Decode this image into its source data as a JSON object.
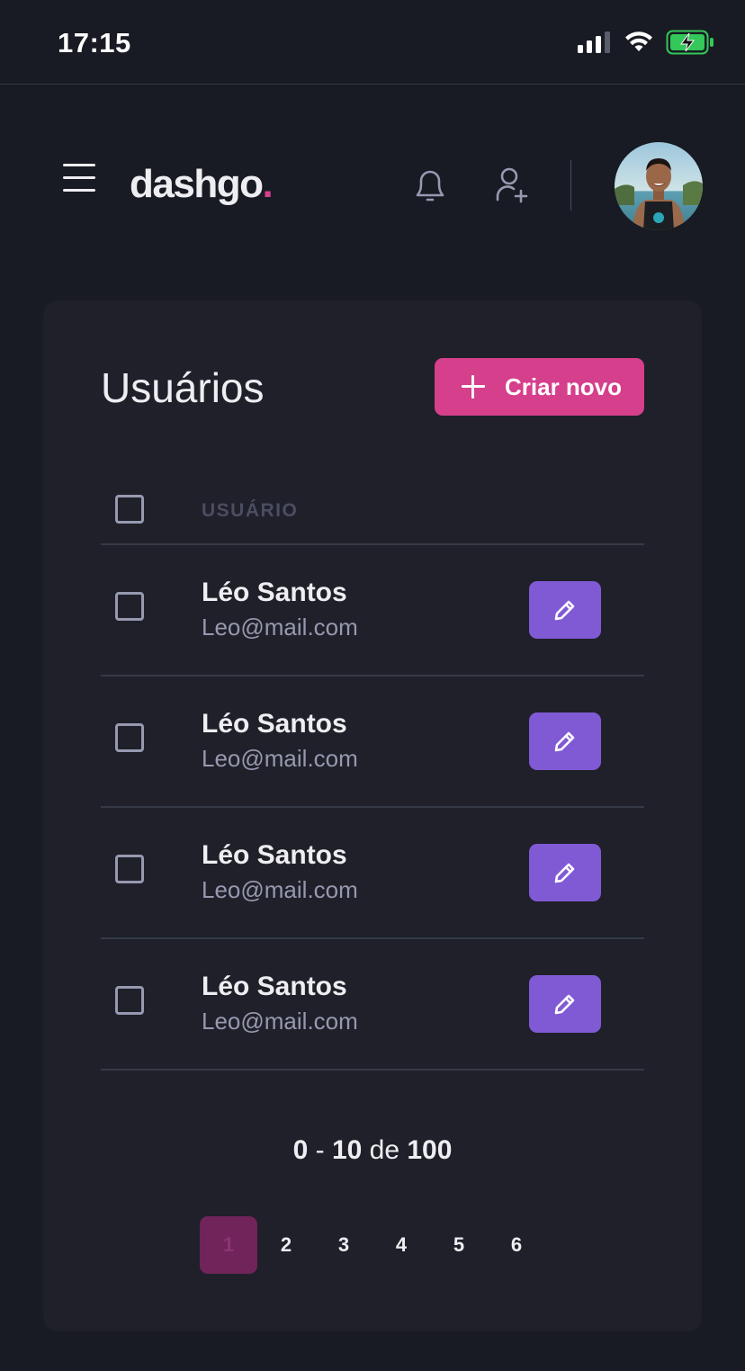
{
  "status_bar": {
    "time": "17:15"
  },
  "header": {
    "logo_text": "dashgo",
    "logo_dot": ".",
    "accent_color": "#d53f8c"
  },
  "users_card": {
    "title": "Usuários",
    "create_button_label": "Criar novo",
    "column_user": "USUÁRIO",
    "rows": [
      {
        "name": "Léo Santos",
        "email": "Leo@mail.com"
      },
      {
        "name": "Léo Santos",
        "email": "Leo@mail.com"
      },
      {
        "name": "Léo Santos",
        "email": "Leo@mail.com"
      },
      {
        "name": "Léo Santos",
        "email": "Leo@mail.com"
      }
    ],
    "edit_button_color": "#805ad5"
  },
  "pagination": {
    "range_start": "0",
    "range_sep": "-",
    "range_end": "10",
    "of_word": "de",
    "total": "100",
    "pages": [
      "1",
      "2",
      "3",
      "4",
      "5",
      "6"
    ],
    "current_page": "1"
  }
}
